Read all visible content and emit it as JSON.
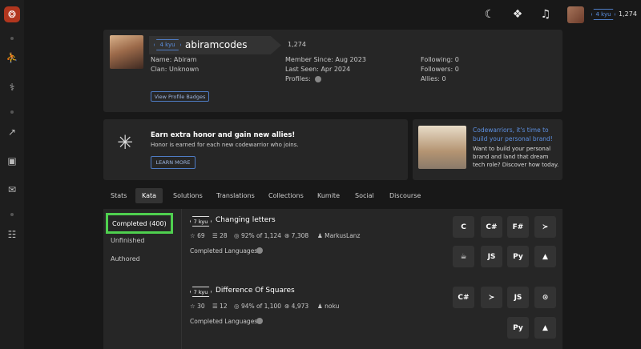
{
  "topbar": {
    "rank": "4 kyu",
    "honor": "1,274"
  },
  "icons": {
    "logo": "❂",
    "nav": [
      "⛹",
      "⚕",
      "↗",
      "▣",
      "✉",
      "☷"
    ],
    "moon": "☾",
    "bookmark": "❖",
    "bell": "♫"
  },
  "profile": {
    "rank": "4 kyu",
    "username": "abiramcodes",
    "honor": "1,274",
    "name": "Name: Abiram",
    "clan": "Clan: Unknown",
    "member_since": "Member Since: Aug 2023",
    "last_seen": "Last Seen: Apr 2024",
    "profiles": "Profiles:",
    "following": "Following: 0",
    "followers": "Followers: 0",
    "allies": "Allies: 0",
    "badges_button": "View Profile Badges"
  },
  "promo": {
    "title": "Earn extra honor and gain new allies!",
    "text": "Honor is earned for each new codewarrior who joins.",
    "button": "LEARN MORE"
  },
  "promo2": {
    "title": "Codewarriors, it's time to build your personal brand!",
    "text": "Want to build your personal brand and land that dream tech role? Discover how today."
  },
  "tabs": [
    "Stats",
    "Kata",
    "Solutions",
    "Translations",
    "Collections",
    "Kumite",
    "Social",
    "Discourse"
  ],
  "subnav": [
    "Completed (400)",
    "Unfinished",
    "Authored"
  ],
  "katas": [
    {
      "kyu": "7 kyu",
      "title": "Changing letters",
      "stars": "69",
      "collections": "28",
      "satisfaction": "92% of 1,124",
      "completed": "7,308",
      "author": "MarkusLanz",
      "languages_label": "Completed Languages:",
      "langs": [
        "C",
        "C#",
        "F#",
        "≻",
        "☕",
        "JS",
        "Py",
        "▲"
      ]
    },
    {
      "kyu": "7 kyu",
      "title": "Difference Of Squares",
      "stars": "30",
      "collections": "12",
      "satisfaction": "94% of 1,100",
      "completed": "4,973",
      "author": "noku",
      "languages_label": "Completed Languages:",
      "langs": [
        "C#",
        "≻",
        "JS",
        "⊙",
        "Py",
        "▲"
      ]
    }
  ]
}
